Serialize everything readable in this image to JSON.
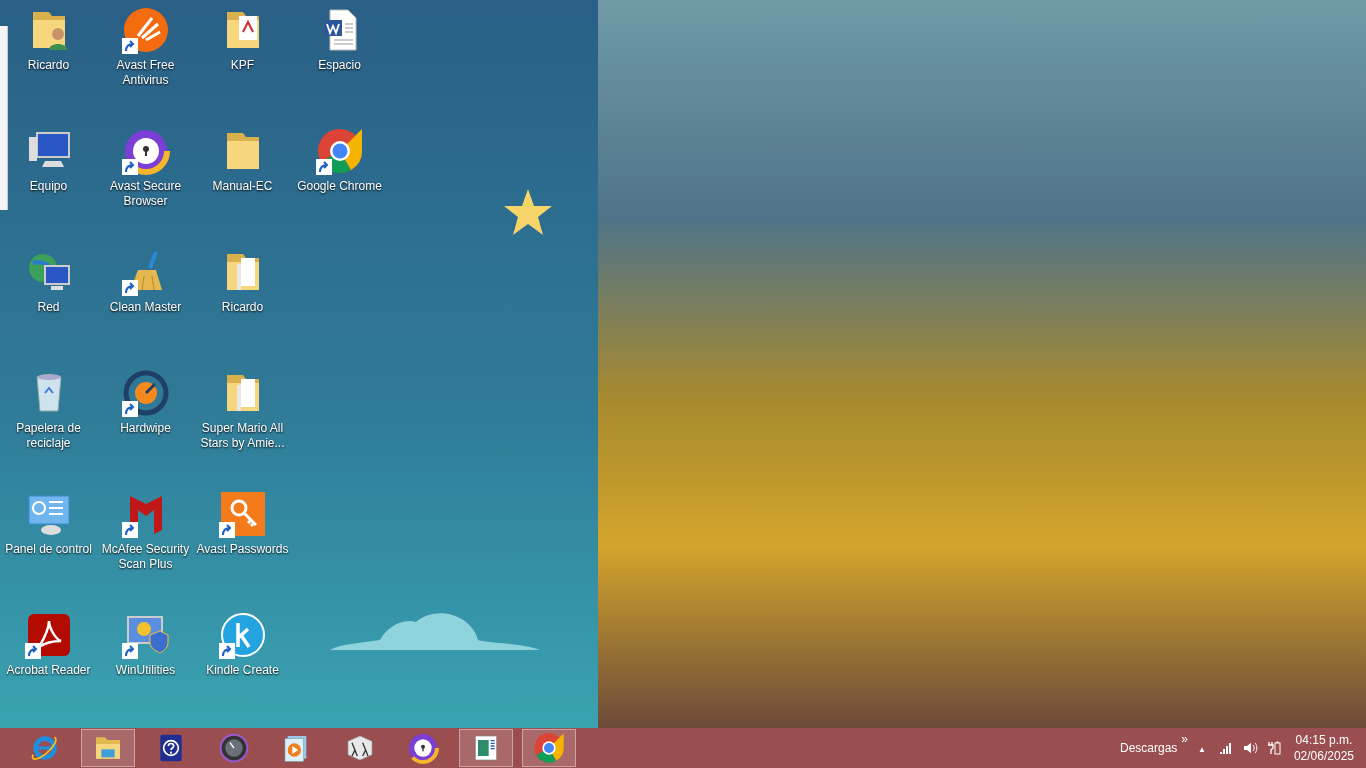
{
  "desktop": {
    "rows": [
      [
        {
          "label": "Ricardo",
          "kind": "folder-user",
          "shortcut": false
        },
        {
          "label": "Avast Free Antivirus",
          "kind": "avast",
          "shortcut": true
        },
        {
          "label": "KPF",
          "kind": "folder-pdf",
          "shortcut": false
        },
        {
          "label": "Espacio",
          "kind": "word-doc",
          "shortcut": false
        }
      ],
      [
        {
          "label": "Equipo",
          "kind": "computer",
          "shortcut": false
        },
        {
          "label": "Avast Secure Browser",
          "kind": "secure-browser",
          "shortcut": true
        },
        {
          "label": "Manual-EC",
          "kind": "folder",
          "shortcut": false
        },
        {
          "label": "Google Chrome",
          "kind": "chrome",
          "shortcut": true
        }
      ],
      [
        {
          "label": "Red",
          "kind": "network",
          "shortcut": false
        },
        {
          "label": "Clean Master",
          "kind": "broom",
          "shortcut": true
        },
        {
          "label": "Ricardo",
          "kind": "folder-files",
          "shortcut": false
        }
      ],
      [
        {
          "label": "Papelera de reciclaje",
          "kind": "recycle-bin",
          "shortcut": false
        },
        {
          "label": "Hardwipe",
          "kind": "hardwipe",
          "shortcut": true
        },
        {
          "label": "Super Mario All Stars by Amie...",
          "kind": "folder-files",
          "shortcut": false
        }
      ],
      [
        {
          "label": "Panel de control",
          "kind": "control-panel",
          "shortcut": false
        },
        {
          "label": "McAfee Security Scan Plus",
          "kind": "mcafee",
          "shortcut": true
        },
        {
          "label": "Avast Passwords",
          "kind": "key",
          "shortcut": true
        }
      ],
      [
        {
          "label": "Acrobat Reader",
          "kind": "acrobat",
          "shortcut": true
        },
        {
          "label": "WinUtilities",
          "kind": "utilities",
          "shortcut": true
        },
        {
          "label": "Kindle Create",
          "kind": "kindle",
          "shortcut": true
        }
      ]
    ]
  },
  "taskbar": {
    "items": [
      {
        "kind": "ie",
        "running": false
      },
      {
        "kind": "explorer",
        "running": true
      },
      {
        "kind": "help",
        "running": false
      },
      {
        "kind": "dial",
        "running": false
      },
      {
        "kind": "media",
        "running": false
      },
      {
        "kind": "lambda",
        "running": false
      },
      {
        "kind": "secure-browser",
        "running": false
      },
      {
        "kind": "app-window",
        "running": true
      },
      {
        "kind": "chrome",
        "running": true
      }
    ],
    "tray": {
      "toolbar_label": "Descargas",
      "toolbar_chevron": "»",
      "overflow_caret": "▲",
      "time": "04:15 p.m.",
      "date": "02/06/2025"
    }
  }
}
